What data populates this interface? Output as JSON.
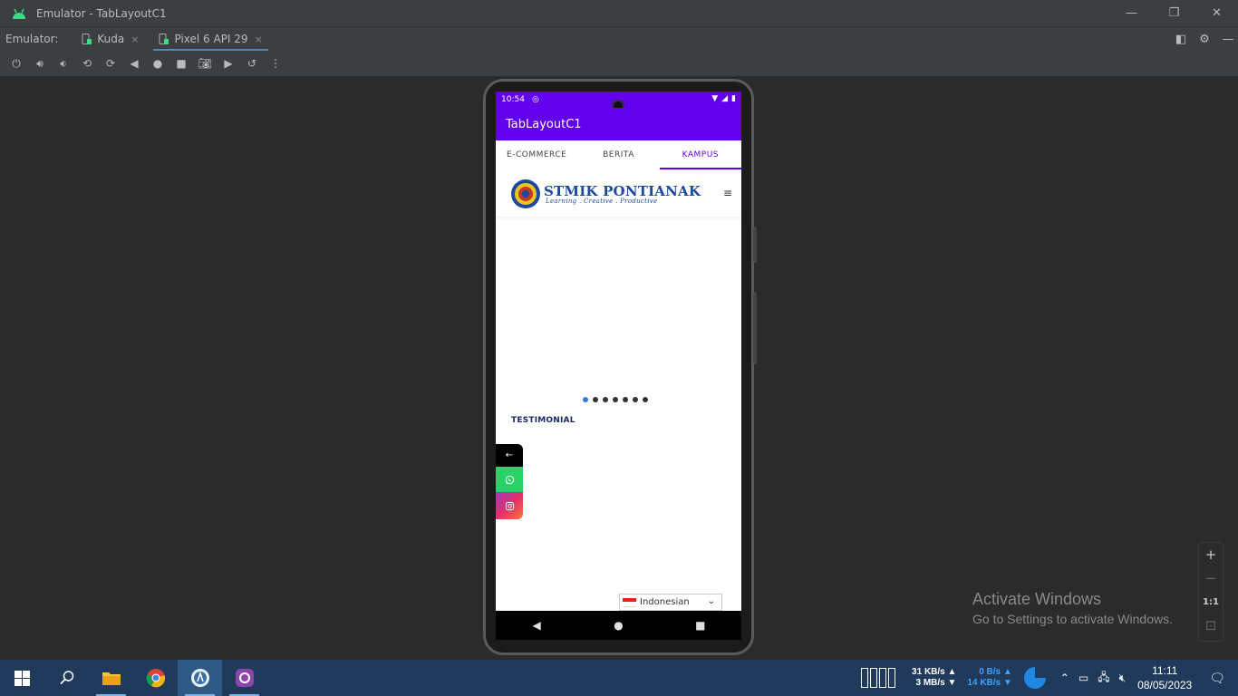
{
  "window": {
    "title": "Emulator - TabLayoutC1",
    "minimize": "—",
    "restore": "❐",
    "close": "✕"
  },
  "emulator_tabs": {
    "label": "Emulator:",
    "tabs": [
      {
        "label": "Kuda",
        "close": "×"
      },
      {
        "label": "Pixel 6 API 29",
        "close": "×"
      }
    ]
  },
  "device": {
    "status_time": "10:54",
    "app_title": "TabLayoutC1",
    "tabs": [
      "E-COMMERCE",
      "BERITA",
      "KAMPUS"
    ],
    "active_tab": "KAMPUS",
    "site": {
      "logo_name": "STMIK PONTIANAK",
      "logo_tagline": "Learning . Creative . Productive",
      "menu_icon": "≡",
      "carousel_dots": 7,
      "active_dot": 0,
      "section_title": "TESTIMONIAL",
      "language": "Indonesian"
    },
    "social": [
      "←",
      "whatsapp-icon",
      "instagram-icon"
    ]
  },
  "zoom": {
    "plus": "+",
    "minus": "−",
    "one_to_one": "1:1",
    "fit": "⊡"
  },
  "activate_windows": {
    "line1": "Activate Windows",
    "line2": "Go to Settings to activate Windows."
  },
  "taskbar": {
    "net_up": "31 KB/s",
    "net_down": "3 MB/s",
    "disk_read": "0 B/s",
    "disk_write": "14 KB/s",
    "time": "11:11",
    "date": "08/05/2023"
  },
  "colors": {
    "accent_purple": "#6200ee",
    "active_dot": "#2d7be5",
    "whatsapp": "#25d366",
    "taskbar": "#1f3a5a"
  }
}
